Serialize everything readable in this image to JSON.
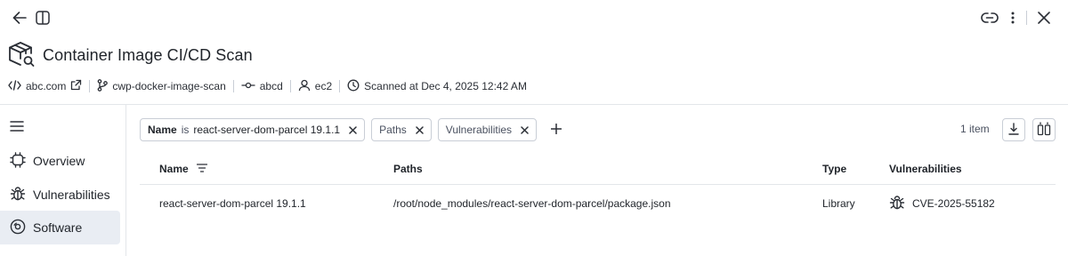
{
  "header": {
    "title": "Container Image CI/CD Scan"
  },
  "meta": {
    "domain": "abc.com",
    "repo": "cwp-docker-image-scan",
    "commit": "abcd",
    "user": "ec2",
    "scanned": "Scanned at Dec 4, 2025 12:42 AM"
  },
  "sidebar": {
    "items": [
      {
        "label": "Overview",
        "icon": "chip-icon"
      },
      {
        "label": "Vulnerabilities",
        "icon": "bug-icon"
      },
      {
        "label": "Software",
        "icon": "disc-icon",
        "active": true
      }
    ]
  },
  "filters": [
    {
      "key": "Name",
      "op": "is",
      "value": "react-server-dom-parcel 19.1.1"
    },
    {
      "value": "Paths"
    },
    {
      "value": "Vulnerabilities"
    }
  ],
  "results": {
    "count": "1 item"
  },
  "table": {
    "columns": [
      "Name",
      "Paths",
      "Type",
      "Vulnerabilities"
    ],
    "rows": [
      {
        "name": "react-server-dom-parcel 19.1.1",
        "path": "/root/node_modules/react-server-dom-parcel/package.json",
        "type": "Library",
        "vulnerability": "CVE-2025-55182"
      }
    ]
  },
  "colors": {
    "active_bg": "#e9edf3",
    "border": "#c9ced6",
    "text": "#1f2329"
  }
}
